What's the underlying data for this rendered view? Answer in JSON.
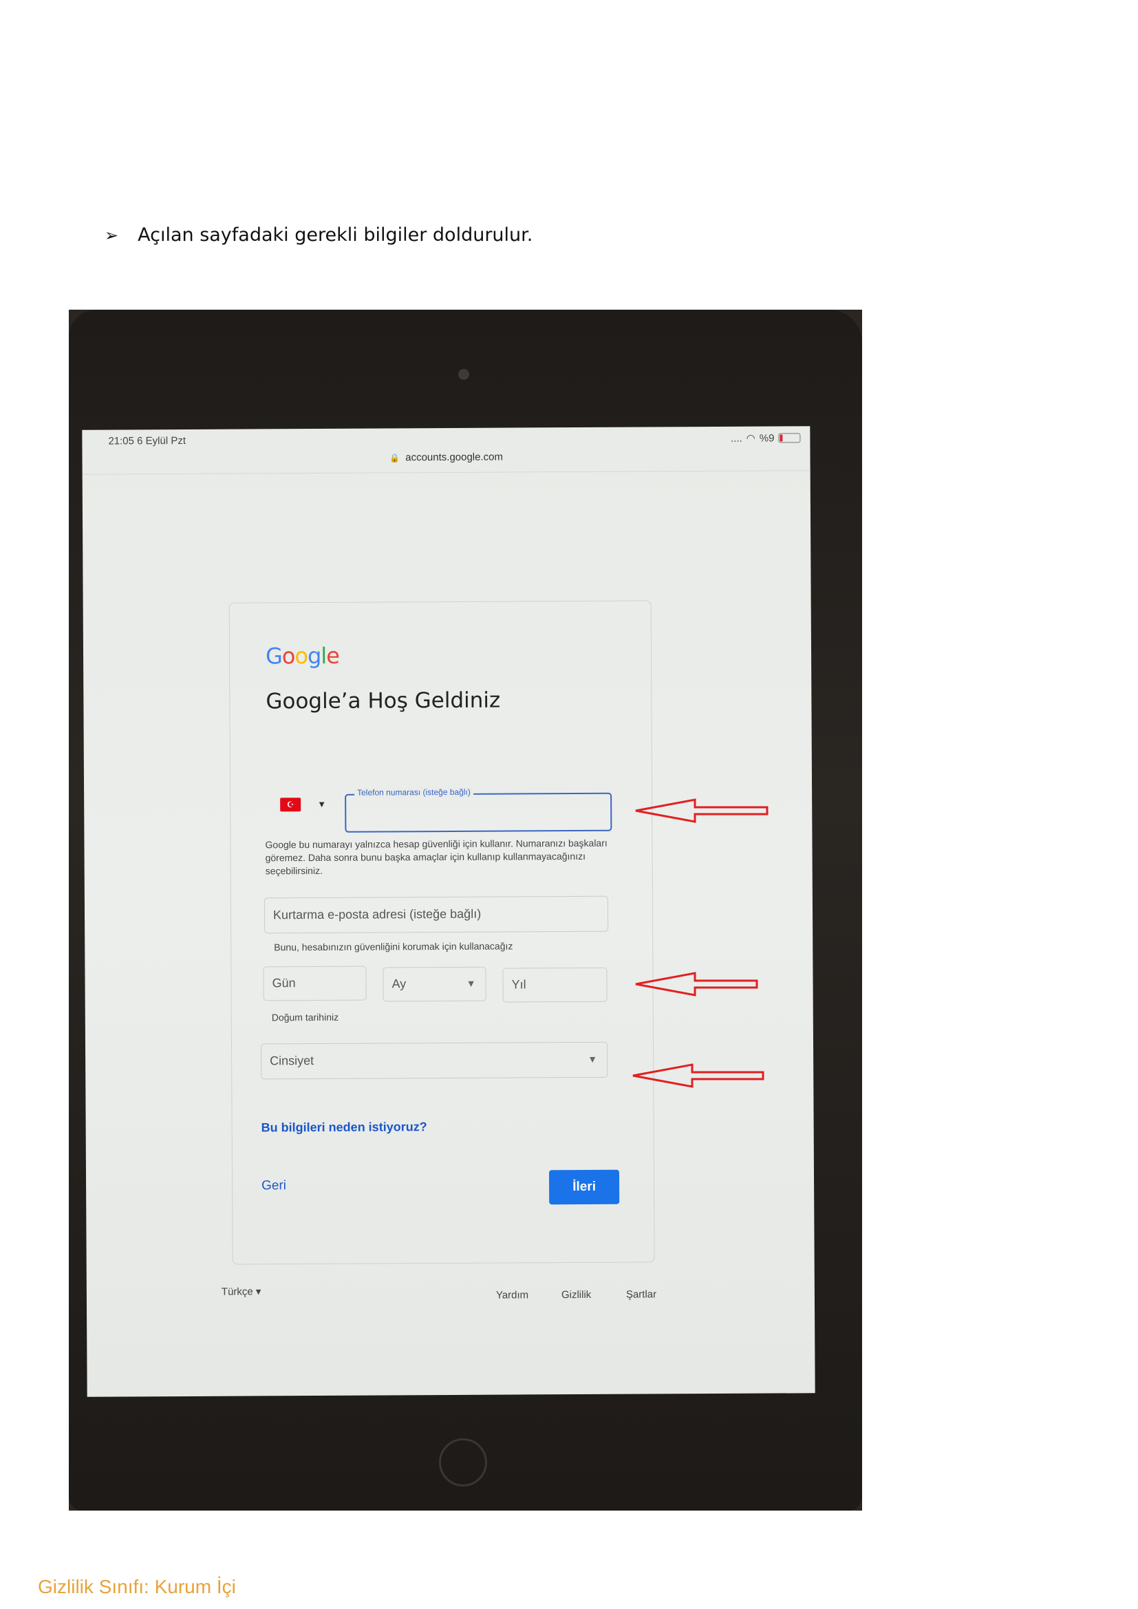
{
  "document": {
    "instruction_bullet": "➢",
    "instruction_text": "Açılan sayfadaki gerekli bilgiler doldurulur.",
    "classification_footer": "Gizlilik Sınıfı: Kurum İçi"
  },
  "device": {
    "status_time": "21:05   6 Eylül Pzt",
    "status_signal": "....",
    "status_battery": "%9",
    "url": "accounts.google.com"
  },
  "form": {
    "logo": [
      "G",
      "o",
      "o",
      "g",
      "l",
      "e"
    ],
    "title": "Google’a Hoş Geldiniz",
    "country_flag": "☪",
    "phone_label": "Telefon numarası (isteğe bağlı)",
    "phone_help": "Google bu numarayı yalnızca hesap güvenliği için kullanır. Numaranızı başkaları göremez. Daha sonra bunu başka amaçlar için kullanıp kullanmayacağınızı seçebilirsiniz.",
    "recovery_placeholder": "Kurtarma e-posta adresi (isteğe bağlı)",
    "recovery_help": "Bunu, hesabınızın güvenliğini korumak için kullanacağız",
    "day_placeholder": "Gün",
    "month_placeholder": "Ay",
    "year_placeholder": "Yıl",
    "dob_help": "Doğum tarihiniz",
    "gender_placeholder": "Cinsiyet",
    "why_link": "Bu bilgileri neden istiyoruz?",
    "back_label": "Geri",
    "next_label": "İleri"
  },
  "footer": {
    "language": "Türkçe",
    "help": "Yardım",
    "privacy": "Gizlilik",
    "terms": "Şartlar"
  },
  "colors": {
    "annotation_arrow": "#e02020",
    "google_blue": "#4285f4",
    "button_blue": "#1a73e8",
    "classification_orange": "#e8a23a"
  }
}
